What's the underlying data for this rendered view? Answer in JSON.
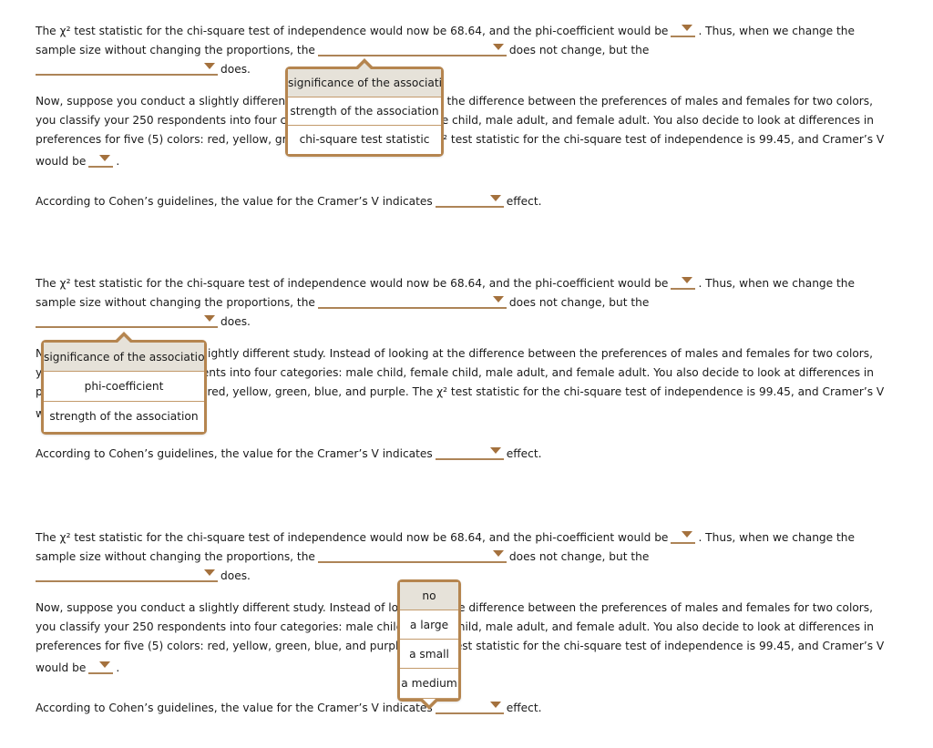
{
  "colors": {
    "accent": "#ad8457",
    "caret": "#a4713d",
    "popup_border": "#b5854f",
    "popup_divider": "#c39a6b",
    "selected_bg": "#e6e2d9",
    "text": "#1a1a1a",
    "page_bg": "#ffffff"
  },
  "question": {
    "stem_line1_a": "The χ² test statistic for the chi-square test of independence would now be 68.64, and the phi-coefficient would be",
    "stem_line1_b": ". Thus, when we change the",
    "stem_line2_a": "sample size without changing the proportions, the",
    "stem_line2_b": "does not change, but the",
    "stem_line3_b": "does.",
    "para_line1_a": "Now, suppose you conduct a slightly different study. Instead of looking at the difference between the preferences of males and females for two colors,",
    "para_line2_a": "you classify your 250 respondents into four categories: male child, female child, male adult, and female adult. You also decide to look at differences in",
    "para_line3_a": "preferences for five (5) colors: red, yellow, green, blue, and purple. The χ² test statistic for the chi-square test of independence is 99.45, and Cramer’s V",
    "para_line4_a": "would be",
    "para_line4_b": ".",
    "cohen_a": "According to Cohen’s guidelines, the value for the Cramer’s V indicates",
    "cohen_b": "effect."
  },
  "popups": [
    {
      "id": "popup-association-1",
      "pointer": "up",
      "options": [
        {
          "label": "significance of the association",
          "selected": true
        },
        {
          "label": "strength of the association",
          "selected": false
        },
        {
          "label": "chi-square test statistic",
          "selected": false
        }
      ]
    },
    {
      "id": "popup-association-2",
      "pointer": "up",
      "options": [
        {
          "label": "significance of the association",
          "selected": true
        },
        {
          "label": "phi-coefficient",
          "selected": false
        },
        {
          "label": "strength of the association",
          "selected": false
        }
      ]
    },
    {
      "id": "popup-effect-size",
      "pointer": "down",
      "options": [
        {
          "label": "no",
          "selected": true
        },
        {
          "label": "a large",
          "selected": false
        },
        {
          "label": "a small",
          "selected": false
        },
        {
          "label": "a medium",
          "selected": false
        }
      ]
    }
  ],
  "dropdowns": {
    "phi_value": "",
    "unchanged_measure": "",
    "changed_measure": "",
    "cramers_v_value": "",
    "effect_size": ""
  }
}
